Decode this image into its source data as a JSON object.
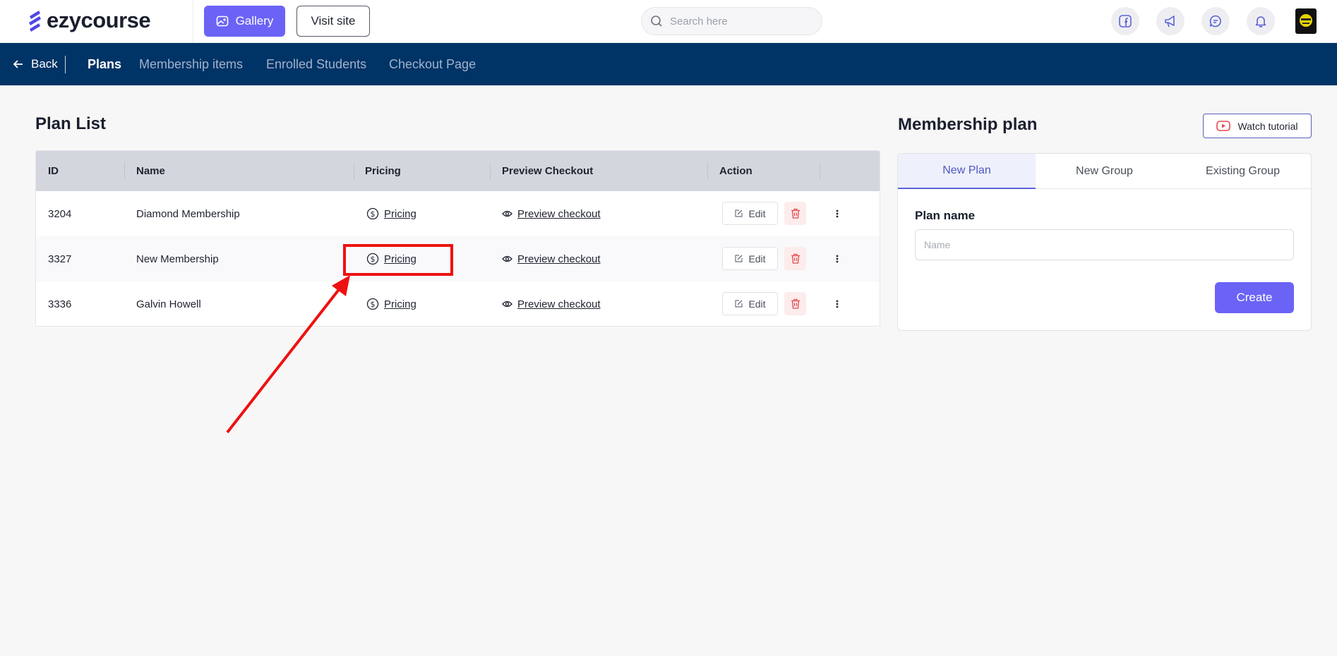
{
  "header": {
    "logo_text": "ezycourse",
    "gallery_label": "Gallery",
    "visit_site_label": "Visit site",
    "search_placeholder": "Search here",
    "icons": [
      "facebook-icon",
      "megaphone-icon",
      "chat-icon",
      "bell-icon"
    ]
  },
  "nav": {
    "back_label": "Back",
    "tabs": [
      {
        "label": "Plans",
        "active": true
      },
      {
        "label": "Membership items",
        "active": false
      },
      {
        "label": "Enrolled Students",
        "active": false
      },
      {
        "label": "Checkout Page",
        "active": false
      }
    ]
  },
  "plan_list": {
    "title": "Plan List",
    "columns": [
      "ID",
      "Name",
      "Pricing",
      "Preview Checkout",
      "Action"
    ],
    "rows": [
      {
        "id": "3204",
        "name": "Diamond Membership",
        "pricing": "Pricing",
        "preview": "Preview checkout",
        "edit": "Edit"
      },
      {
        "id": "3327",
        "name": "New Membership",
        "pricing": "Pricing",
        "preview": "Preview checkout",
        "edit": "Edit"
      },
      {
        "id": "3336",
        "name": "Galvin Howell",
        "pricing": "Pricing",
        "preview": "Preview checkout",
        "edit": "Edit"
      }
    ]
  },
  "membership_panel": {
    "title": "Membership plan",
    "tutorial_label": "Watch tutorial",
    "tabs": [
      {
        "label": "New Plan",
        "active": true
      },
      {
        "label": "New Group",
        "active": false
      },
      {
        "label": "Existing Group",
        "active": false
      }
    ],
    "plan_name_label": "Plan name",
    "plan_name_placeholder": "Name",
    "plan_name_value": "",
    "create_label": "Create"
  },
  "colors": {
    "accent": "#6b63f6",
    "navbar": "#003366",
    "annotation": "#ee1111",
    "delete": "#e5484d"
  }
}
